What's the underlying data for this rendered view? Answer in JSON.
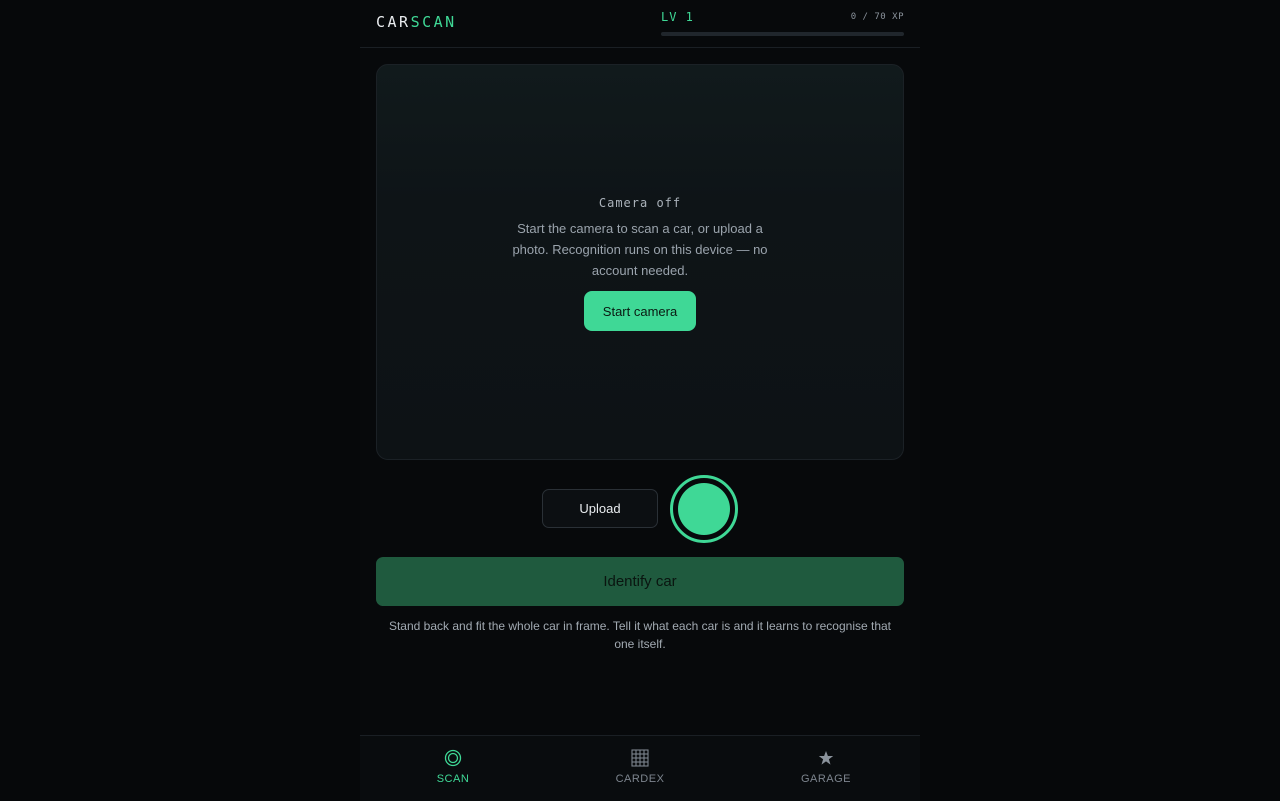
{
  "header": {
    "logo_part1": "CAR",
    "logo_part2": "SCAN",
    "level": "LV 1",
    "xp_text": "0 / 70 XP",
    "xp_progress_fraction": 0
  },
  "camera": {
    "status_title": "Camera off",
    "description": "Start the camera to scan a car, or upload a photo. Recognition runs on this device — no account needed.",
    "start_label": "Start camera"
  },
  "controls": {
    "upload_label": "Upload",
    "identify_label": "Identify car"
  },
  "hint": "Stand back and fit the whole car in frame. Tell it what each car is and it learns to recognise that one itself.",
  "nav": {
    "items": [
      {
        "label": "SCAN",
        "icon": "scan-target-icon",
        "active": true
      },
      {
        "label": "CARDEX",
        "icon": "grid-icon",
        "active": false
      },
      {
        "label": "GARAGE",
        "icon": "star-icon",
        "active": false
      }
    ]
  },
  "colors": {
    "accent": "#3fd896",
    "accent_dim": "#1f5a3e",
    "background": "#07090b",
    "muted_text": "#7d858e"
  }
}
